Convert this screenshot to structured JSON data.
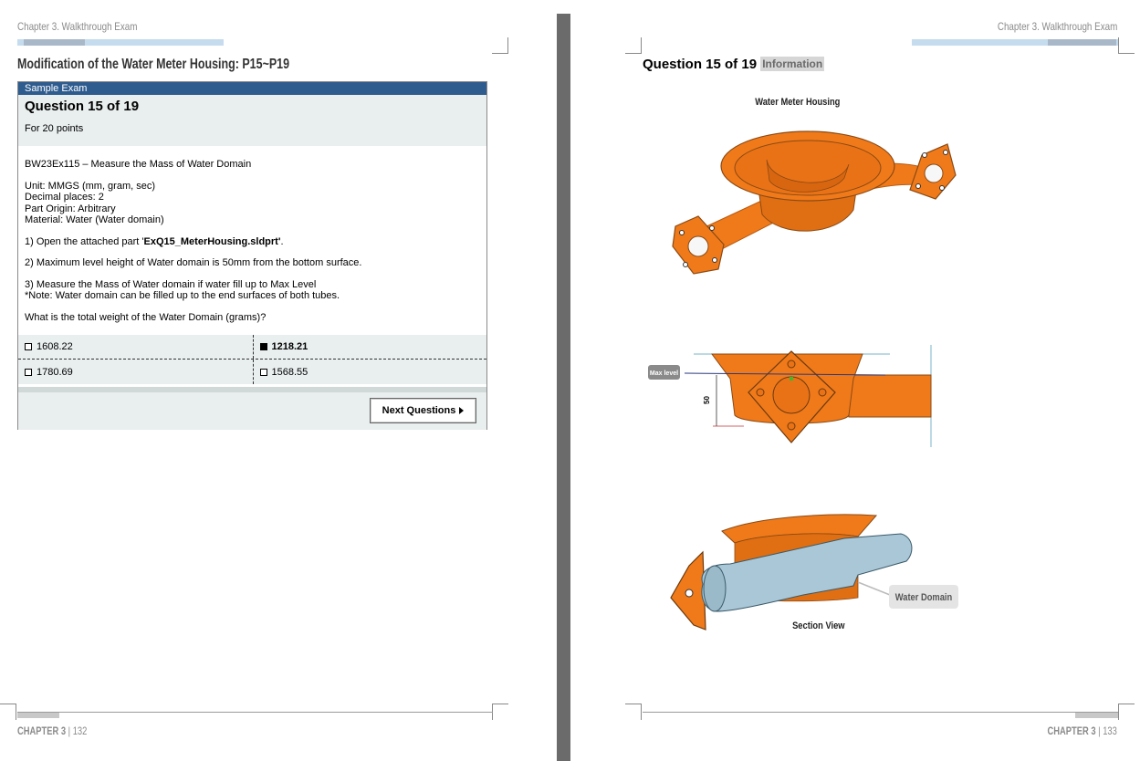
{
  "left_page": {
    "chapter_header": "Chapter 3. Walkthrough Exam",
    "section_title": "Modification of the Water Meter Housing: P15~P19",
    "exam": {
      "banner": "Sample Exam",
      "question_title": "Question 15 of 19",
      "points": "For 20 points",
      "task_title": "BW23Ex115 – Measure the Mass of Water Domain",
      "unit": "Unit: MMGS (mm, gram, sec)",
      "decimal": "Decimal places: 2",
      "origin": "Part Origin: Arbitrary",
      "material": "Material: Water (Water domain)",
      "step1_prefix": "1) Open the attached part '",
      "step1_file": "ExQ15_MeterHousing.sldprt'",
      "step1_suffix": ".",
      "step2": "2) Maximum level height of Water domain is 50mm from the bottom surface.",
      "step3": "3) Measure the Mass of Water domain if water fill up to Max Level",
      "step3_note": "*Note: Water domain can be filled up to the end surfaces of both tubes.",
      "question": "What is the total weight of the Water Domain (grams)?",
      "answers": [
        {
          "label": "1608.22",
          "selected": false
        },
        {
          "label": "1218.21",
          "selected": true
        },
        {
          "label": "1780.69",
          "selected": false
        },
        {
          "label": "1568.55",
          "selected": false
        }
      ],
      "next_button": "Next Questions"
    },
    "footer": {
      "chapter": "CHAPTER 3",
      "page": "132"
    }
  },
  "right_page": {
    "chapter_header": "Chapter 3. Walkthrough Exam",
    "question_title": "Question 15 of 19",
    "info_badge": "Information",
    "fig1_label": "Water Meter Housing",
    "max_level_label": "Max level",
    "dimension_value": "50",
    "water_domain_label": "Water Domain",
    "section_view_label": "Section View",
    "footer": {
      "chapter": "CHAPTER 3",
      "page": "133"
    }
  },
  "colors": {
    "part_orange": "#f07a1a",
    "exam_banner": "#2f5c8f",
    "water_blue": "#a9c7d6",
    "gutter": "#6b6b6b"
  }
}
